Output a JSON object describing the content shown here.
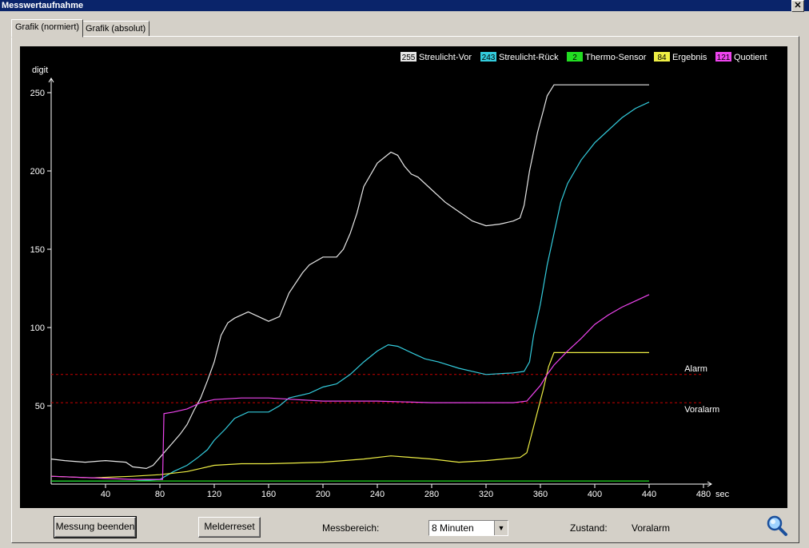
{
  "window": {
    "title": "Messwertaufnahme",
    "close_label": "✕"
  },
  "tabs": [
    {
      "label": "Grafik (normiert)",
      "active": true
    },
    {
      "label": "Grafik (absolut)",
      "active": false
    }
  ],
  "controls": {
    "stop_button": "Messung beenden",
    "reset_button": "Melderreset",
    "range_label": "Messbereich:",
    "range_value": "8 Minuten",
    "state_label": "Zustand:",
    "state_value": "Voralarm",
    "zoom_icon": "magnifier-icon"
  },
  "chart_data": {
    "type": "line",
    "ylabel": "digit",
    "xlabel": "sec",
    "xlim": [
      0,
      480
    ],
    "ylim": [
      0,
      250
    ],
    "x_ticks": [
      40,
      80,
      120,
      160,
      200,
      240,
      280,
      320,
      360,
      400,
      440,
      480
    ],
    "y_ticks": [
      50,
      100,
      150,
      200,
      250
    ],
    "grid": false,
    "legend_position": "top-right",
    "colors": {
      "background": "#000000",
      "axis": "#ffffff",
      "threshold": "#cc0000"
    },
    "thresholds": [
      {
        "name": "Alarm",
        "value": 70
      },
      {
        "name": "Voralarm",
        "value": 52
      }
    ],
    "series": [
      {
        "name": "Streulicht-Vor",
        "current": "255",
        "color": "#e6e6e6",
        "points": [
          [
            0,
            16
          ],
          [
            10,
            15
          ],
          [
            25,
            14
          ],
          [
            40,
            15
          ],
          [
            55,
            14
          ],
          [
            60,
            11
          ],
          [
            70,
            10
          ],
          [
            75,
            12
          ],
          [
            80,
            17
          ],
          [
            85,
            22
          ],
          [
            90,
            27
          ],
          [
            95,
            32
          ],
          [
            100,
            38
          ],
          [
            105,
            47
          ],
          [
            110,
            55
          ],
          [
            115,
            66
          ],
          [
            120,
            78
          ],
          [
            125,
            95
          ],
          [
            130,
            103
          ],
          [
            135,
            106
          ],
          [
            145,
            110
          ],
          [
            150,
            108
          ],
          [
            160,
            104
          ],
          [
            168,
            107
          ],
          [
            175,
            122
          ],
          [
            185,
            135
          ],
          [
            190,
            140
          ],
          [
            200,
            145
          ],
          [
            210,
            145
          ],
          [
            215,
            150
          ],
          [
            220,
            160
          ],
          [
            225,
            173
          ],
          [
            230,
            190
          ],
          [
            240,
            205
          ],
          [
            250,
            212
          ],
          [
            255,
            210
          ],
          [
            260,
            203
          ],
          [
            265,
            198
          ],
          [
            270,
            196
          ],
          [
            280,
            188
          ],
          [
            290,
            180
          ],
          [
            300,
            174
          ],
          [
            310,
            168
          ],
          [
            320,
            165
          ],
          [
            330,
            166
          ],
          [
            340,
            168
          ],
          [
            345,
            170
          ],
          [
            348,
            178
          ],
          [
            352,
            200
          ],
          [
            358,
            225
          ],
          [
            362,
            238
          ],
          [
            365,
            248
          ],
          [
            370,
            255
          ],
          [
            440,
            255
          ]
        ]
      },
      {
        "name": "Streulicht-Rück",
        "current": "243",
        "color": "#33ccdd",
        "points": [
          [
            0,
            2
          ],
          [
            60,
            2
          ],
          [
            80,
            3
          ],
          [
            90,
            8
          ],
          [
            100,
            12
          ],
          [
            108,
            17
          ],
          [
            115,
            22
          ],
          [
            120,
            28
          ],
          [
            128,
            35
          ],
          [
            135,
            42
          ],
          [
            145,
            46
          ],
          [
            160,
            46
          ],
          [
            168,
            50
          ],
          [
            175,
            55
          ],
          [
            180,
            56
          ],
          [
            190,
            58
          ],
          [
            200,
            62
          ],
          [
            210,
            64
          ],
          [
            220,
            70
          ],
          [
            230,
            78
          ],
          [
            240,
            85
          ],
          [
            248,
            89
          ],
          [
            255,
            88
          ],
          [
            265,
            84
          ],
          [
            275,
            80
          ],
          [
            285,
            78
          ],
          [
            300,
            74
          ],
          [
            310,
            72
          ],
          [
            320,
            70
          ],
          [
            340,
            71
          ],
          [
            348,
            72
          ],
          [
            352,
            78
          ],
          [
            355,
            95
          ],
          [
            360,
            115
          ],
          [
            365,
            140
          ],
          [
            370,
            160
          ],
          [
            375,
            180
          ],
          [
            380,
            192
          ],
          [
            390,
            207
          ],
          [
            400,
            218
          ],
          [
            410,
            226
          ],
          [
            420,
            234
          ],
          [
            430,
            240
          ],
          [
            440,
            244
          ]
        ]
      },
      {
        "name": "Thermo-Sensor",
        "current": "2",
        "color": "#22dd22",
        "points": [
          [
            0,
            2
          ],
          [
            440,
            2
          ]
        ]
      },
      {
        "name": "Ergebnis",
        "current": "84",
        "color": "#eeee44",
        "points": [
          [
            0,
            5
          ],
          [
            30,
            4
          ],
          [
            60,
            5
          ],
          [
            80,
            6
          ],
          [
            100,
            8
          ],
          [
            110,
            10
          ],
          [
            120,
            12
          ],
          [
            140,
            13
          ],
          [
            160,
            13
          ],
          [
            200,
            14
          ],
          [
            230,
            16
          ],
          [
            250,
            18
          ],
          [
            280,
            16
          ],
          [
            300,
            14
          ],
          [
            320,
            15
          ],
          [
            345,
            17
          ],
          [
            350,
            20
          ],
          [
            356,
            40
          ],
          [
            362,
            60
          ],
          [
            366,
            75
          ],
          [
            370,
            84
          ],
          [
            440,
            84
          ]
        ]
      },
      {
        "name": "Quotient",
        "current": "121",
        "color": "#ee44ee",
        "points": [
          [
            0,
            5
          ],
          [
            60,
            3
          ],
          [
            78,
            3
          ],
          [
            82,
            3
          ],
          [
            83,
            45
          ],
          [
            90,
            46
          ],
          [
            100,
            48
          ],
          [
            110,
            52
          ],
          [
            120,
            54
          ],
          [
            140,
            55
          ],
          [
            160,
            55
          ],
          [
            180,
            54
          ],
          [
            200,
            53
          ],
          [
            240,
            53
          ],
          [
            280,
            52
          ],
          [
            320,
            52
          ],
          [
            340,
            52
          ],
          [
            350,
            53
          ],
          [
            355,
            58
          ],
          [
            360,
            63
          ],
          [
            365,
            70
          ],
          [
            370,
            76
          ],
          [
            380,
            85
          ],
          [
            390,
            93
          ],
          [
            400,
            102
          ],
          [
            410,
            108
          ],
          [
            420,
            113
          ],
          [
            430,
            117
          ],
          [
            440,
            121
          ]
        ]
      }
    ]
  }
}
